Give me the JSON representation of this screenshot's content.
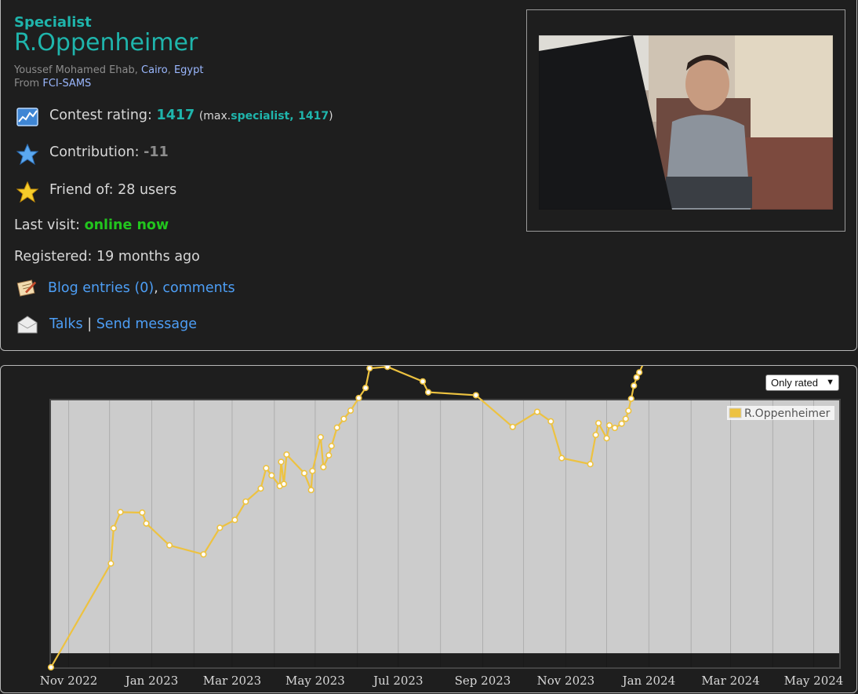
{
  "profile": {
    "rank": "Specialist",
    "handle": "R.Oppenheimer",
    "name": "Youssef Mohamed Ehab",
    "city": "Cairo",
    "country": "Egypt",
    "from_label": "From",
    "organization": "FCI-SAMS",
    "rating_label": "Contest rating:",
    "rating": "1417",
    "max_prefix": "(max.",
    "max_rank": "specialist,",
    "max_rating": "1417",
    "max_suffix": ")",
    "contribution_label": "Contribution:",
    "contribution": "-11",
    "friend_label": "Friend of:",
    "friend_count": "28 users",
    "last_visit_label": "Last visit:",
    "last_visit": "online now",
    "registered_label": "Registered:",
    "registered": "19 months ago",
    "blog_label": "Blog entries (0)",
    "comments_label": "comments",
    "talks_label": "Talks",
    "separator": "|",
    "send_message_label": "Send message",
    "icons": [
      "rating-chart-icon",
      "star-icon",
      "gold-star-icon",
      "blog-icon",
      "envelope-icon"
    ],
    "colors": {
      "specialist": "#1fb5ac",
      "online": "#22c51e",
      "link": "#4d9ef5"
    }
  },
  "graph": {
    "filter_selected": "Only rated",
    "chart_data": {
      "type": "line",
      "series": [
        {
          "name": "R.Oppenheimer",
          "color": "#edc240"
        }
      ],
      "x_ticks": [
        "Nov 2022",
        "Jan 2023",
        "Mar 2023",
        "May 2023",
        "Jul 2023",
        "Sep 2023",
        "Nov 2023",
        "Jan 2024",
        "Mar 2024",
        "May 2024"
      ],
      "y_ticks": [
        "1900",
        "1600",
        "1400",
        "1200"
      ],
      "legend_position": "top-right",
      "bands": [
        {
          "from": 1900,
          "to": 2100,
          "color": "#ff88ff"
        },
        {
          "from": 1600,
          "to": 1900,
          "color": "#aaaaff"
        },
        {
          "from": 1400,
          "to": 1600,
          "color": "#77ddbb"
        },
        {
          "from": 1200,
          "to": 1400,
          "color": "#77ff77"
        },
        {
          "from": 0,
          "to": 1200,
          "color": "#cccccc"
        }
      ],
      "points": [
        [
          "2022-10-19",
          -56
        ],
        [
          "2022-12-02",
          357
        ],
        [
          "2022-12-04",
          497
        ],
        [
          "2022-12-09",
          561
        ],
        [
          "2022-12-25",
          559
        ],
        [
          "2022-12-28",
          516
        ],
        [
          "2023-01-14",
          429
        ],
        [
          "2023-02-08",
          393
        ],
        [
          "2023-02-20",
          499
        ],
        [
          "2023-03-03",
          530
        ],
        [
          "2023-03-11",
          603
        ],
        [
          "2023-03-22",
          655
        ],
        [
          "2023-03-26",
          736
        ],
        [
          "2023-03-30",
          707
        ],
        [
          "2023-04-05",
          665
        ],
        [
          "2023-04-06",
          761
        ],
        [
          "2023-04-08",
          673
        ],
        [
          "2023-04-10",
          790
        ],
        [
          "2023-04-23",
          716
        ],
        [
          "2023-04-28",
          649
        ],
        [
          "2023-04-29",
          725
        ],
        [
          "2023-05-05",
          859
        ],
        [
          "2023-05-07",
          740
        ],
        [
          "2023-05-11",
          787
        ],
        [
          "2023-05-13",
          824
        ],
        [
          "2023-05-17",
          897
        ],
        [
          "2023-05-22",
          932
        ],
        [
          "2023-05-27",
          965
        ],
        [
          "2023-06-02",
          1015
        ],
        [
          "2023-06-07",
          1055
        ],
        [
          "2023-06-10",
          1133
        ],
        [
          "2023-06-23",
          1139
        ],
        [
          "2023-07-19",
          1081
        ],
        [
          "2023-07-23",
          1038
        ],
        [
          "2023-08-27",
          1026
        ],
        [
          "2023-09-23",
          900
        ],
        [
          "2023-10-11",
          960
        ],
        [
          "2023-10-21",
          922
        ],
        [
          "2023-10-29",
          776
        ],
        [
          "2023-11-19",
          752
        ],
        [
          "2023-11-23",
          868
        ],
        [
          "2023-11-25",
          915
        ],
        [
          "2023-12-01",
          855
        ],
        [
          "2023-12-03",
          906
        ],
        [
          "2023-12-07",
          896
        ],
        [
          "2023-12-12",
          913
        ],
        [
          "2023-12-15",
          932
        ],
        [
          "2023-12-17",
          964
        ],
        [
          "2023-12-19",
          1012
        ],
        [
          "2023-12-21",
          1064
        ],
        [
          "2023-12-23",
          1097
        ],
        [
          "2023-12-25",
          1117
        ],
        [
          "2024-01-06",
          1262
        ],
        [
          "2024-01-12",
          1277
        ],
        [
          "2024-01-14",
          1289
        ],
        [
          "2024-01-17",
          1305
        ],
        [
          "2024-01-25",
          1287
        ],
        [
          "2024-01-28",
          1306
        ],
        [
          "2024-02-04",
          1299
        ],
        [
          "2024-02-08",
          1322
        ],
        [
          "2024-02-11",
          1354
        ],
        [
          "2024-02-13",
          1390
        ],
        [
          "2024-02-14",
          1323
        ],
        [
          "2024-02-16",
          1202
        ],
        [
          "2024-02-20",
          1180
        ],
        [
          "2024-02-24",
          1225
        ],
        [
          "2024-02-26",
          1207
        ],
        [
          "2024-03-01",
          1236
        ],
        [
          "2024-03-07",
          1304
        ],
        [
          "2024-03-10",
          1262
        ],
        [
          "2024-03-13",
          1298
        ],
        [
          "2024-03-24",
          1353
        ],
        [
          "2024-03-26",
          1374
        ],
        [
          "2024-04-06",
          1393
        ],
        [
          "2024-04-09",
          1409
        ],
        [
          "2024-04-11",
          1335
        ],
        [
          "2024-04-18",
          1268
        ],
        [
          "2024-04-26",
          1276
        ],
        [
          "2024-04-29",
          1343
        ],
        [
          "2024-05-06",
          1377
        ],
        [
          "2024-05-18",
          1417
        ]
      ]
    }
  }
}
